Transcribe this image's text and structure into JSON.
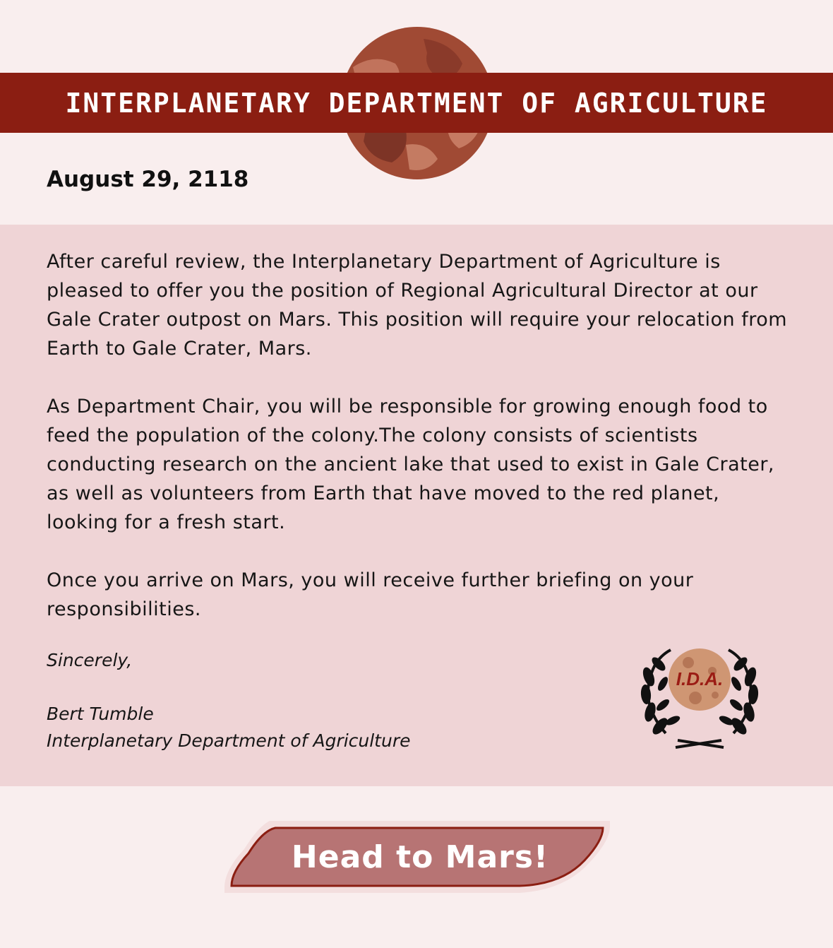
{
  "header": {
    "title": "INTERPLANETARY DEPARTMENT OF AGRICULTURE",
    "planet_icon": "mars-planet-icon"
  },
  "letter": {
    "date": "August 29, 2118",
    "paragraphs": [
      "After careful review, the Interplanetary Department of Agriculture is pleased to offer you the position of Regional Agricultural Director at our Gale Crater outpost on Mars. This position will require your relocation from Earth to Gale Crater, Mars.",
      "As Department Chair, you will be responsible for growing enough food to feed the population of the colony.The colony consists of scientists conducting research on the ancient lake that used to exist in Gale Crater, as well as volunteers from Earth that have moved to the red planet, looking for a fresh start.",
      "Once you arrive on Mars, you will receive further briefing on your responsibilities."
    ],
    "closing": "Sincerely,",
    "signer_name": "Bert Tumble",
    "signer_org": "Interplanetary Department of Agriculture"
  },
  "seal": {
    "text": "I.D.A.",
    "icon": "laurel-wreath-seal-icon"
  },
  "cta": {
    "label": "Head to Mars!"
  },
  "colors": {
    "banner": "#8b1e12",
    "page_background": "#f9eeee",
    "panel_background": "#efd4d6",
    "button_fill": "#b77474",
    "button_border": "#8b1e12"
  }
}
